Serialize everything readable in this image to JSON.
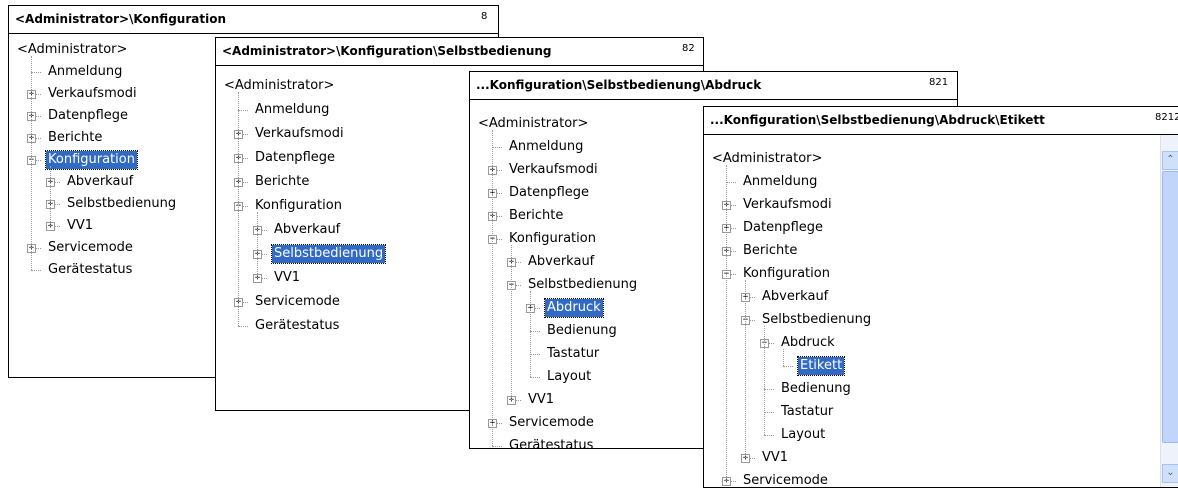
{
  "windows": [
    {
      "title": "<Administrator>\\Konfiguration",
      "number": "8",
      "items": [
        {
          "label": "<Administrator>",
          "level": 0,
          "expander": "none",
          "selected": false
        },
        {
          "label": "Anmeldung",
          "level": 1,
          "expander": "none",
          "selected": false
        },
        {
          "label": "Verkaufsmodi",
          "level": 1,
          "expander": "plus",
          "selected": false
        },
        {
          "label": "Datenpflege",
          "level": 1,
          "expander": "plus",
          "selected": false
        },
        {
          "label": "Berichte",
          "level": 1,
          "expander": "plus",
          "selected": false
        },
        {
          "label": "Konfiguration",
          "level": 1,
          "expander": "minus",
          "selected": true
        },
        {
          "label": "Abverkauf",
          "level": 2,
          "expander": "plus",
          "selected": false
        },
        {
          "label": "Selbstbedienung",
          "level": 2,
          "expander": "plus",
          "selected": false
        },
        {
          "label": "VV1",
          "level": 2,
          "expander": "plus",
          "selected": false
        },
        {
          "label": "Servicemode",
          "level": 1,
          "expander": "plus",
          "selected": false
        },
        {
          "label": "Gerätestatus",
          "level": 1,
          "expander": "none",
          "selected": false
        }
      ]
    },
    {
      "title": "<Administrator>\\Konfiguration\\Selbstbedienung",
      "number": "82",
      "items": [
        {
          "label": "<Administrator>",
          "level": 0,
          "expander": "none",
          "selected": false
        },
        {
          "label": "Anmeldung",
          "level": 1,
          "expander": "none",
          "selected": false
        },
        {
          "label": "Verkaufsmodi",
          "level": 1,
          "expander": "plus",
          "selected": false
        },
        {
          "label": "Datenpflege",
          "level": 1,
          "expander": "plus",
          "selected": false
        },
        {
          "label": "Berichte",
          "level": 1,
          "expander": "plus",
          "selected": false
        },
        {
          "label": "Konfiguration",
          "level": 1,
          "expander": "minus",
          "selected": false
        },
        {
          "label": "Abverkauf",
          "level": 2,
          "expander": "plus",
          "selected": false
        },
        {
          "label": "Selbstbedienung",
          "level": 2,
          "expander": "plus",
          "selected": true
        },
        {
          "label": "VV1",
          "level": 2,
          "expander": "plus",
          "selected": false
        },
        {
          "label": "Servicemode",
          "level": 1,
          "expander": "plus",
          "selected": false
        },
        {
          "label": "Gerätestatus",
          "level": 1,
          "expander": "none",
          "selected": false
        }
      ]
    },
    {
      "title": "...Konfiguration\\Selbstbedienung\\Abdruck",
      "number": "821",
      "items": [
        {
          "label": "<Administrator>",
          "level": 0,
          "expander": "none",
          "selected": false
        },
        {
          "label": "Anmeldung",
          "level": 1,
          "expander": "none",
          "selected": false
        },
        {
          "label": "Verkaufsmodi",
          "level": 1,
          "expander": "plus",
          "selected": false
        },
        {
          "label": "Datenpflege",
          "level": 1,
          "expander": "plus",
          "selected": false
        },
        {
          "label": "Berichte",
          "level": 1,
          "expander": "plus",
          "selected": false
        },
        {
          "label": "Konfiguration",
          "level": 1,
          "expander": "minus",
          "selected": false
        },
        {
          "label": "Abverkauf",
          "level": 2,
          "expander": "plus",
          "selected": false
        },
        {
          "label": "Selbstbedienung",
          "level": 2,
          "expander": "minus",
          "selected": false
        },
        {
          "label": "Abdruck",
          "level": 3,
          "expander": "plus",
          "selected": true
        },
        {
          "label": "Bedienung",
          "level": 3,
          "expander": "none",
          "selected": false
        },
        {
          "label": "Tastatur",
          "level": 3,
          "expander": "none",
          "selected": false
        },
        {
          "label": "Layout",
          "level": 3,
          "expander": "none",
          "selected": false
        },
        {
          "label": "VV1",
          "level": 2,
          "expander": "plus",
          "selected": false
        },
        {
          "label": "Servicemode",
          "level": 1,
          "expander": "plus",
          "selected": false
        },
        {
          "label": "Gerätestatus",
          "level": 1,
          "expander": "none",
          "selected": false
        }
      ]
    },
    {
      "title": "...Konfiguration\\Selbstbedienung\\Abdruck\\Etikett",
      "number": "8212",
      "scrollbar": true,
      "items": [
        {
          "label": "<Administrator>",
          "level": 0,
          "expander": "none",
          "selected": false
        },
        {
          "label": "Anmeldung",
          "level": 1,
          "expander": "none",
          "selected": false
        },
        {
          "label": "Verkaufsmodi",
          "level": 1,
          "expander": "plus",
          "selected": false
        },
        {
          "label": "Datenpflege",
          "level": 1,
          "expander": "plus",
          "selected": false
        },
        {
          "label": "Berichte",
          "level": 1,
          "expander": "plus",
          "selected": false
        },
        {
          "label": "Konfiguration",
          "level": 1,
          "expander": "minus",
          "selected": false
        },
        {
          "label": "Abverkauf",
          "level": 2,
          "expander": "plus",
          "selected": false
        },
        {
          "label": "Selbstbedienung",
          "level": 2,
          "expander": "minus",
          "selected": false
        },
        {
          "label": "Abdruck",
          "level": 3,
          "expander": "minus",
          "selected": false
        },
        {
          "label": "Etikett",
          "level": 4,
          "expander": "none",
          "selected": true
        },
        {
          "label": "Bedienung",
          "level": 3,
          "expander": "none",
          "selected": false
        },
        {
          "label": "Tastatur",
          "level": 3,
          "expander": "none",
          "selected": false
        },
        {
          "label": "Layout",
          "level": 3,
          "expander": "none",
          "selected": false
        },
        {
          "label": "VV1",
          "level": 2,
          "expander": "plus",
          "selected": false
        },
        {
          "label": "Servicemode",
          "level": 1,
          "expander": "plus",
          "selected": false
        }
      ]
    }
  ],
  "icons": {
    "expand": "plus-box-icon",
    "collapse": "minus-box-icon",
    "scroll_up": "chevron-up-icon",
    "scroll_down": "chevron-down-icon"
  },
  "colors": {
    "selection": "#316ac5",
    "scrollbar_track": "#eef3fb",
    "scrollbar_thumb": "#c1d5fb"
  }
}
